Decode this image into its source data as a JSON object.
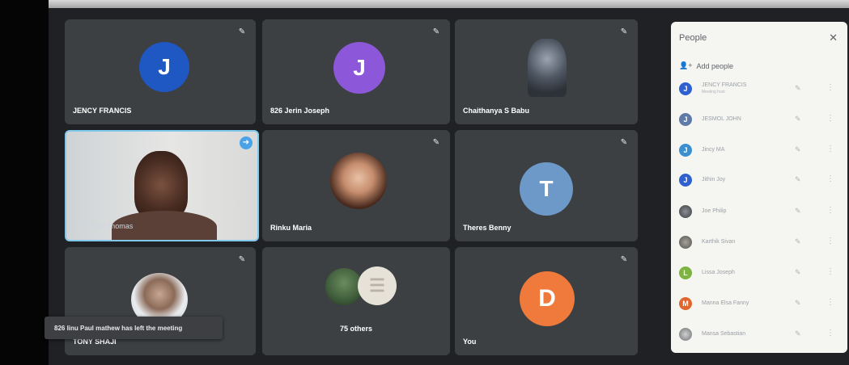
{
  "tiles": [
    {
      "name": "JENCY FRANCIS",
      "initial": "J",
      "color": "#1f57c3",
      "mic": "mic-off-icon"
    },
    {
      "name": "826 Jerin Joseph",
      "initial": "J",
      "color": "#8c57d8",
      "mic": "mic-off-icon"
    },
    {
      "name": "Chaithanya S Babu",
      "mic": "mic-off-icon"
    },
    {
      "name": "Dr. Thera Thomas",
      "mic": "pin-icon"
    },
    {
      "name": "Rinku Maria",
      "mic": "mic-off-icon"
    },
    {
      "name": "Theres Benny",
      "initial": "T",
      "color": "#6d99c8",
      "mic": "mic-off-icon"
    },
    {
      "name": "TONY SHAJI",
      "mic": "mic-off-icon"
    },
    {
      "name": "75 others"
    },
    {
      "name": "You",
      "initial": "D",
      "color": "#ef7a3b",
      "mic": "mic-off-icon"
    }
  ],
  "toast": "826 linu Paul mathew has left the meeting",
  "panel": {
    "title": "People",
    "add_people": "Add people",
    "people": [
      {
        "name": "JENCY FRANCIS",
        "sub": "Meeting host",
        "initial": "J",
        "color": "#2f60d0"
      },
      {
        "name": "JESMOL JOHN",
        "initial": "J",
        "color": "#5f7aa8"
      },
      {
        "name": "Jincy MA",
        "initial": "J",
        "color": "#3a8fd0"
      },
      {
        "name": "Jithin Joy",
        "initial": "J",
        "color": "#2f60d0"
      },
      {
        "name": "Joe Philip",
        "initial": "",
        "color": "#555a60"
      },
      {
        "name": "Karthik Sivan",
        "initial": "",
        "color": "#6a6f74"
      },
      {
        "name": "Lissa Joseph",
        "initial": "L",
        "color": "#7cb342"
      },
      {
        "name": "Manna Elsa Fanny",
        "initial": "M",
        "color": "#e0662f"
      },
      {
        "name": "Mansa Sebastian",
        "initial": "",
        "color": "#7a7f84"
      }
    ]
  }
}
